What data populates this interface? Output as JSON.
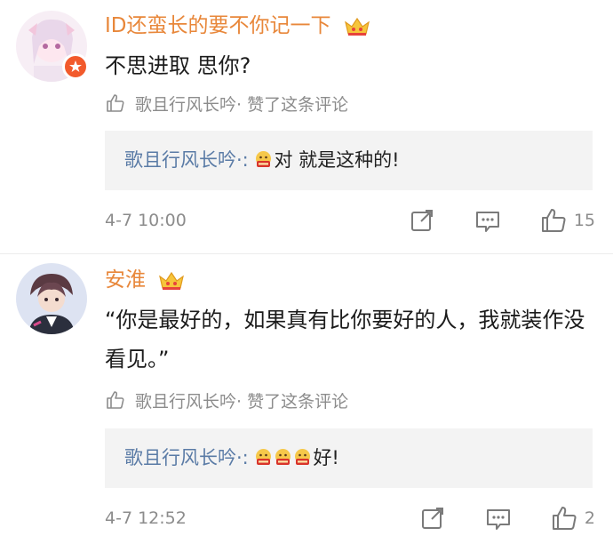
{
  "comments": [
    {
      "username": "ID还蛮长的要不你记一下",
      "content": "不思进取  思你?",
      "liked_by": "歌且行风长吟· 赞了这条评论",
      "reply_author": "歌且行风长吟·:",
      "reply_text": "对 就是这种的!",
      "reply_emoji_count": 1,
      "emoji_label": "吃瓜",
      "time": "4-7 10:00",
      "likes": "15"
    },
    {
      "username": "安淮",
      "content": "“你是最好的，如果真有比你要好的人，我就装作没看见。”",
      "liked_by": "歌且行风长吟· 赞了这条评论",
      "reply_author": "歌且行风长吟·:",
      "reply_text": "好!",
      "reply_emoji_count": 3,
      "emoji_label": "吃瓜",
      "time": "4-7 12:52",
      "likes": "2"
    }
  ],
  "icons": {
    "crown": "crown-icon",
    "thumb": "thumbs-up-icon",
    "share": "share-icon",
    "comment": "comment-icon"
  },
  "colors": {
    "username": "#e8873a",
    "reply_author": "#5a7ba6",
    "meta": "#8c8c8c",
    "reply_bg": "#f3f3f3",
    "badge": "#f25a2c"
  }
}
